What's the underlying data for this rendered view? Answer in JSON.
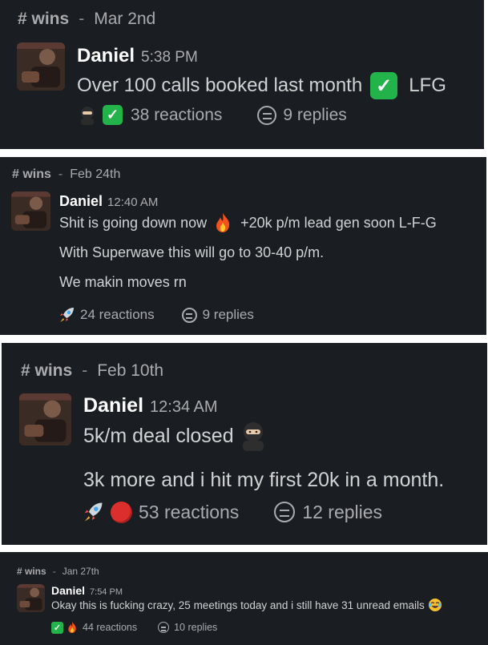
{
  "posts": [
    {
      "channel": "# wins",
      "separator": "-",
      "date": "Mar 2nd",
      "author": "Daniel",
      "time": "5:38 PM",
      "lines": [
        "Over 100 calls booked last month",
        "LFG"
      ],
      "reactions_label": "38 reactions",
      "replies_label": "9 replies"
    },
    {
      "channel": "# wins",
      "separator": "-",
      "date": "Feb 24th",
      "author": "Daniel",
      "time": "12:40 AM",
      "lines": [
        "Shit is going down now",
        "+20k p/m lead gen soon L-F-G",
        "With Superwave this will go to 30-40 p/m.",
        "We makin moves rn"
      ],
      "reactions_label": "24 reactions",
      "replies_label": "9 replies"
    },
    {
      "channel": "# wins",
      "separator": "-",
      "date": "Feb 10th",
      "author": "Daniel",
      "time": "12:34 AM",
      "lines": [
        "5k/m deal closed",
        "3k more and i hit my first 20k in a month."
      ],
      "reactions_label": "53 reactions",
      "replies_label": "12 replies"
    },
    {
      "channel": "# wins",
      "separator": "-",
      "date": "Jan 27th",
      "author": "Daniel",
      "time": "7:54 PM",
      "lines": [
        "Okay this is fucking crazy, 25 meetings today and i still have 31 unread emails"
      ],
      "reactions_label": "44 reactions",
      "replies_label": "10 replies"
    }
  ],
  "icons": {
    "check": "white-check-mark-icon",
    "fire": "fire-icon",
    "rocket": "rocket-icon",
    "ninja": "ninja-icon",
    "red_circle": "red-circle-icon",
    "joy": "joy-icon",
    "replies": "thread-replies-icon"
  },
  "colors": {
    "card_bg": "#1a1d21",
    "text": "#d1d2d3",
    "muted": "#ababad",
    "check_green": "#22b34a",
    "red": "#dd2e2e"
  }
}
